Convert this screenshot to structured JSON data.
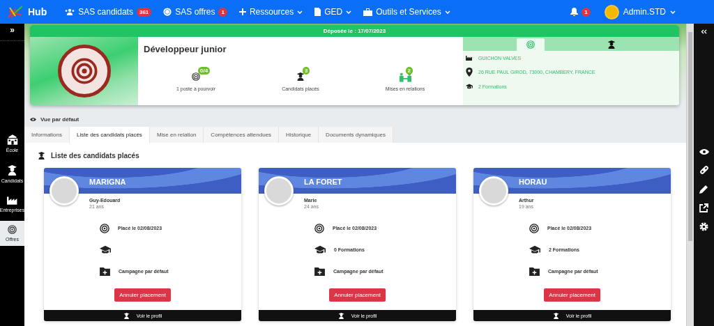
{
  "topbar": {
    "logo": "Hub",
    "nav": [
      {
        "label": "SAS candidats",
        "badge": "361",
        "dropdown": false
      },
      {
        "label": "SAS offres",
        "badge": "1",
        "dropdown": false
      },
      {
        "label": "Ressources",
        "dropdown": true
      },
      {
        "label": "GED",
        "dropdown": true
      },
      {
        "label": "Outils et Services",
        "dropdown": true
      }
    ],
    "notification_badge": "1",
    "user": "Admin.STD"
  },
  "sidebar": {
    "toggle": "»",
    "items": [
      {
        "label": "École",
        "selected": false
      },
      {
        "label": "Candidats",
        "selected": false
      },
      {
        "label": "Entreprises",
        "selected": false
      },
      {
        "label": "Offres",
        "selected": true
      }
    ]
  },
  "offer": {
    "deposited": "Déposée le : 17/07/2023",
    "title": "Développeur junior",
    "stats": [
      {
        "badge": "0/4",
        "label": "1 poste à pourvoir"
      },
      {
        "badge": "3",
        "label": "Candidats placés"
      },
      {
        "badge": "2",
        "label": "Mises en relations"
      }
    ],
    "side_tabs": [
      {
        "selected": true
      },
      {
        "selected": false
      }
    ],
    "company": "GUICHON VALVES",
    "address": "26 RUE PAUL GIROD, 73000, CHAMBERY, FRANCE",
    "formations": "2 Formations"
  },
  "view": "Vue par défaut",
  "tabs": [
    {
      "label": "Informations",
      "selected": false
    },
    {
      "label": "Liste des candidats placés",
      "selected": true
    },
    {
      "label": "Mise en relation",
      "selected": false
    },
    {
      "label": "Compétences attendues",
      "selected": false
    },
    {
      "label": "Historique",
      "selected": false
    },
    {
      "label": "Documents dynamiques",
      "selected": false
    }
  ],
  "section_title": "Liste des candidats placés",
  "candidates": [
    {
      "last_name": "MARIGNA",
      "first_name": "Guy-Edouard",
      "age": "21 ans",
      "placed": "Placé le 02/08/2023",
      "campaign": "Campagne par défaut",
      "cancel": "Annuler placement",
      "profile": "Voir le profil"
    },
    {
      "last_name": "LA FORET",
      "first_name": "Marie",
      "age": "24 ans",
      "placed": "Placé le 02/08/2023",
      "formations": "0 Formations",
      "campaign": "Campagne par défaut",
      "cancel": "Annuler placement",
      "profile": "Voir le profil"
    },
    {
      "last_name": "HORAU",
      "first_name": "Arthur",
      "age": "19 ans",
      "placed": "Placé le 02/08/2023",
      "formations": "2 Formations",
      "campaign": "Campagne par défaut",
      "cancel": "Annuler placement",
      "profile": "Voir le profil"
    }
  ]
}
